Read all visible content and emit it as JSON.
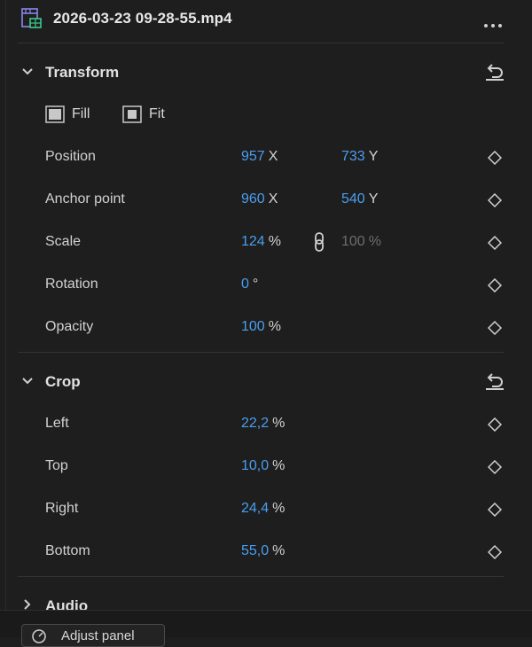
{
  "header": {
    "clip_name": "2026-03-23 09-28-55.mp4",
    "clip_icon": "video-file-icon",
    "more_icon": "more-horizontal-icon"
  },
  "transform": {
    "title": "Transform",
    "expanded": true,
    "reset_icon": "reset-icon",
    "fill_label": "Fill",
    "fit_label": "Fit",
    "position": {
      "label": "Position",
      "x": "957",
      "x_unit": "X",
      "y": "733",
      "y_unit": "Y"
    },
    "anchor": {
      "label": "Anchor point",
      "x": "960",
      "x_unit": "X",
      "y": "540",
      "y_unit": "Y"
    },
    "scale": {
      "label": "Scale",
      "w": "124",
      "w_unit": "%",
      "h": "100",
      "h_unit": "%",
      "link_icon": "link-icon"
    },
    "rotation": {
      "label": "Rotation",
      "value": "0",
      "unit": "°"
    },
    "opacity": {
      "label": "Opacity",
      "value": "100",
      "unit": "%"
    }
  },
  "crop": {
    "title": "Crop",
    "expanded": true,
    "reset_icon": "reset-icon",
    "rows": [
      {
        "label": "Left",
        "value": "22,2",
        "unit": "%"
      },
      {
        "label": "Top",
        "value": "10,0",
        "unit": "%"
      },
      {
        "label": "Right",
        "value": "24,4",
        "unit": "%"
      },
      {
        "label": "Bottom",
        "value": "55,0",
        "unit": "%"
      }
    ]
  },
  "audio": {
    "title": "Audio",
    "expanded": false
  },
  "footer": {
    "adjust_label": "Adjust panel"
  },
  "colors": {
    "background": "#1e1e1e",
    "value_blue": "#4a9ef0",
    "dim_value": "#6e6e6e"
  }
}
